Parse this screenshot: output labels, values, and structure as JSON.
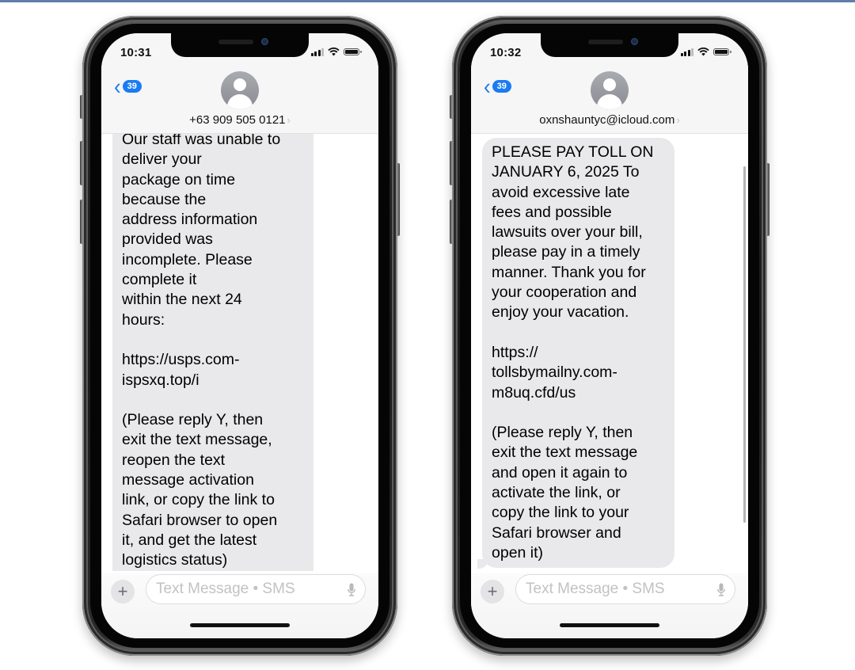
{
  "phones": [
    {
      "status": {
        "time": "10:31"
      },
      "nav": {
        "back_count": "39",
        "back_icon": "chevron-left"
      },
      "contact": {
        "name": "+63 909 505 0121",
        "chevron": "›"
      },
      "message": {
        "text": "Our staff was unable to\ndeliver your\npackage on time\nbecause the\naddress information\nprovided was\nincomplete. Please\ncomplete it\nwithin the next 24\nhours:\n\nhttps://usps.com-\nispsxq.top/i\n\n(Please reply Y, then\nexit the text message,\nreopen the text\nmessage activation\nlink, or copy the link to\nSafari browser to open\nit, and get the latest\nlogistics status)"
      },
      "composer": {
        "placeholder": "Text Message • SMS",
        "value": "",
        "plus_label": "+"
      }
    },
    {
      "status": {
        "time": "10:32"
      },
      "nav": {
        "back_count": "39",
        "back_icon": "chevron-left"
      },
      "contact": {
        "name": "oxnshauntyc@icloud.com",
        "chevron": "›"
      },
      "message": {
        "text": "PLEASE PAY TOLL ON\nJANUARY 6, 2025 To\navoid excessive late\nfees and possible\nlawsuits over your bill,\nplease pay in a timely\nmanner. Thank you for\nyour cooperation and\nenjoy your vacation.\n\nhttps://\ntollsbymailny.com-\nm8uq.cfd/us\n\n(Please reply Y, then\nexit the text message\nand open it again to\nactivate the link, or\ncopy the link to your\nSafari browser and\nopen it)"
      },
      "composer": {
        "placeholder": "Text Message • SMS",
        "value": "",
        "plus_label": "+"
      }
    }
  ],
  "colors": {
    "accent": "#1a7cf3",
    "bubble_received": "#e9e9eb",
    "header_bg": "#f6f6f6",
    "top_rule": "#5f7dab"
  }
}
